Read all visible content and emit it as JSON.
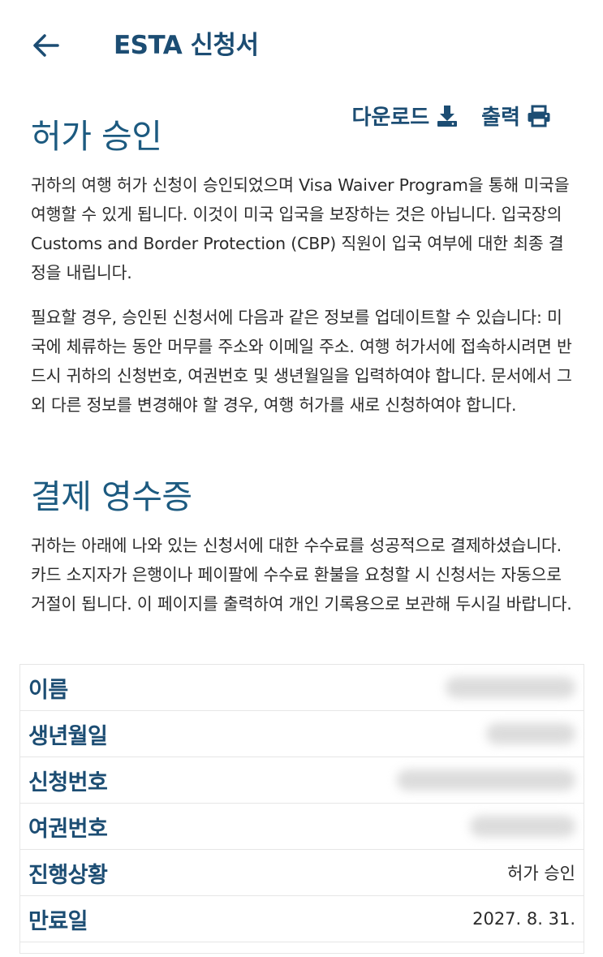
{
  "header": {
    "title": "ESTA 신청서",
    "back_icon": "arrow-left-icon"
  },
  "actions": {
    "download_label": "다운로드",
    "print_label": "출력"
  },
  "approval": {
    "heading": "허가 승인",
    "para1": "귀하의 여행 허가 신청이 승인되었으며 Visa Waiver Program을 통해 미국을 여행할 수 있게 됩니다. 이것이 미국 입국을 보장하는 것은 아닙니다. 입국장의 Customs and Border Protection (CBP) 직원이 입국 여부에 대한 최종 결정을 내립니다.",
    "para2": "필요할 경우, 승인된 신청서에 다음과 같은 정보를 업데이트할 수 있습니다: 미국에 체류하는 동안 머무를 주소와 이메일 주소. 여행 허가서에 접속하시려면 반드시 귀하의 신청번호, 여권번호 및 생년월일을 입력하여야 합니다. 문서에서 그 외 다른 정보를 변경해야 할 경우, 여행 허가를 새로 신청하여야 합니다."
  },
  "receipt": {
    "heading": "결제 영수증",
    "para": "귀하는 아래에 나와 있는 신청서에 대한 수수료를 성공적으로 결제하셨습니다. 카드 소지자가 은행이나 페이팔에 수수료 환불을 요청할 시 신청서는 자동으로 거절이 됩니다. 이 페이지를 출력하여 개인 기록용으로 보관해 두시길 바랍니다."
  },
  "table": {
    "rows": [
      {
        "label": "이름",
        "value": ""
      },
      {
        "label": "생년월일",
        "value": ""
      },
      {
        "label": "신청번호",
        "value": ""
      },
      {
        "label": "여권번호",
        "value": ""
      },
      {
        "label": "진행상황",
        "value": "허가 승인"
      },
      {
        "label": "만료일",
        "value": "2027. 8. 31."
      }
    ]
  }
}
